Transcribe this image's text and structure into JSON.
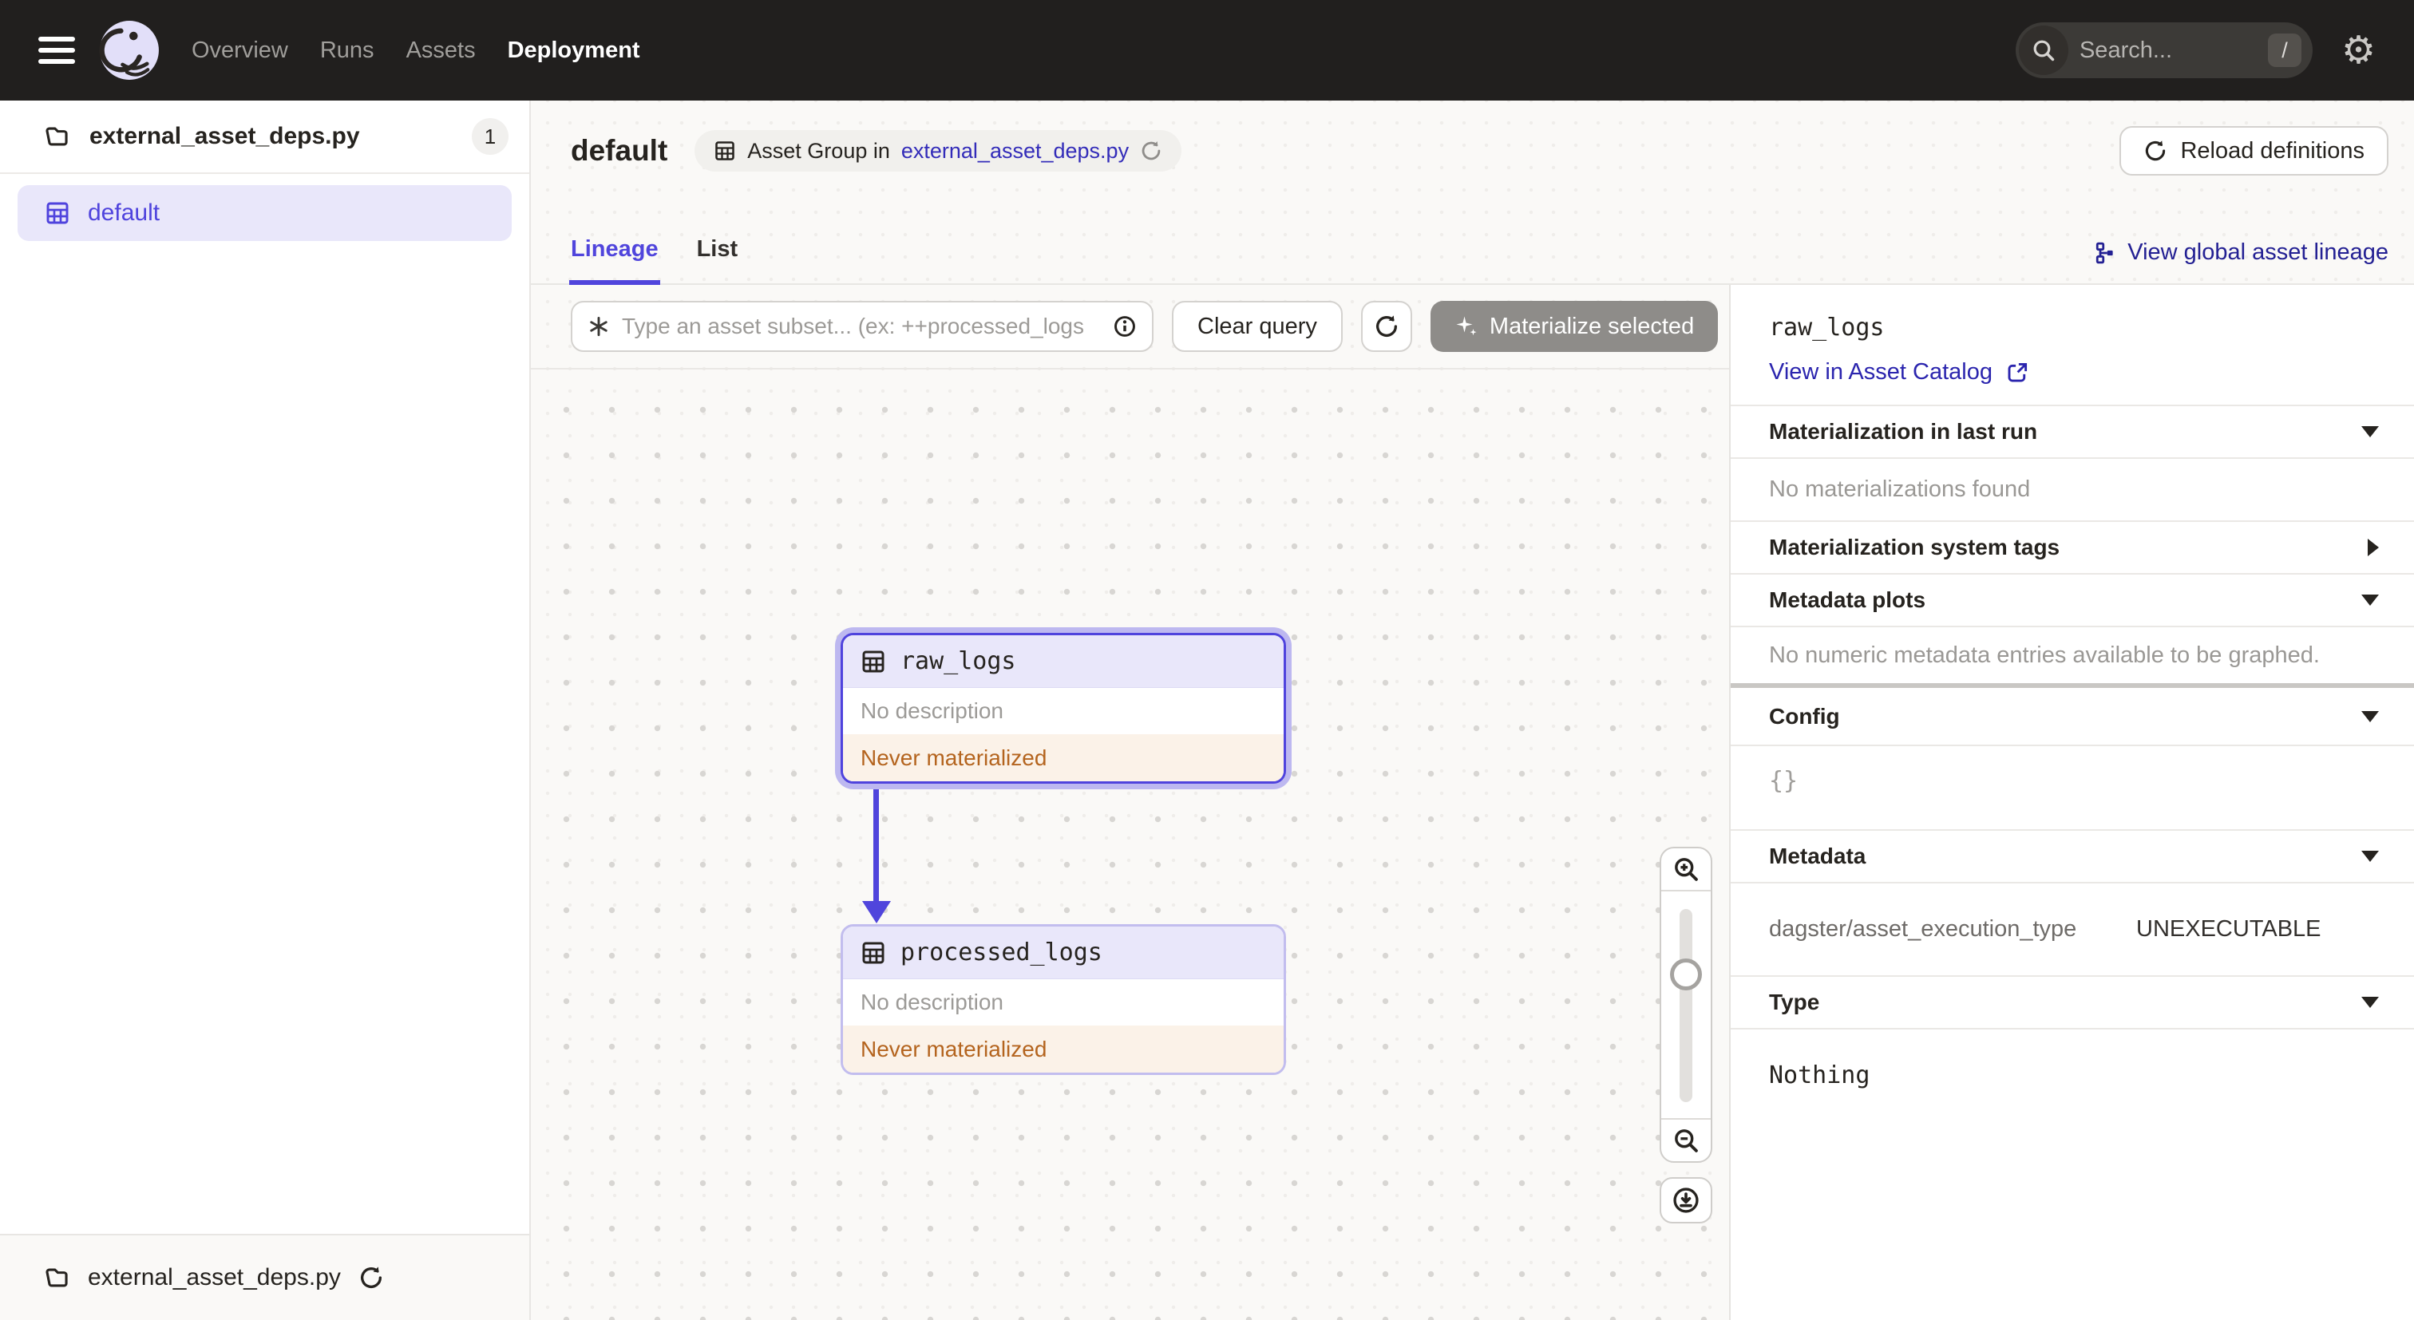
{
  "colors": {
    "accent": "#4F43DD",
    "link": "#2B25AE",
    "nav_bg": "#211F1E",
    "warning_text": "#B4641E",
    "warning_bg": "#FBF2E8",
    "selected_bg": "#E9E7FA"
  },
  "nav": {
    "items": [
      {
        "label": "Overview"
      },
      {
        "label": "Runs"
      },
      {
        "label": "Assets"
      },
      {
        "label": "Deployment"
      }
    ]
  },
  "search": {
    "placeholder": "Search...",
    "shortcut": "/"
  },
  "sidebar": {
    "file": {
      "label": "external_asset_deps.py",
      "count": "1"
    },
    "selected_group": {
      "label": "default"
    },
    "footer": {
      "label": "external_asset_deps.py"
    }
  },
  "header": {
    "title": "default",
    "breadcrumb_prefix": "Asset Group in",
    "breadcrumb_link": "external_asset_deps.py",
    "reload_button": "Reload definitions"
  },
  "tabs": {
    "lineage": "Lineage",
    "list": "List",
    "global_link": "View global asset lineage"
  },
  "toolbar": {
    "query_placeholder": "Type an asset subset... (ex: ++processed_logs",
    "clear_button": "Clear query",
    "materialize_button": "Materialize selected"
  },
  "graph": {
    "nodes": [
      {
        "name": "raw_logs",
        "description": "No description",
        "status": "Never materialized"
      },
      {
        "name": "processed_logs",
        "description": "No description",
        "status": "Never materialized"
      }
    ]
  },
  "panel": {
    "title": "raw_logs",
    "catalog_link": "View in Asset Catalog",
    "sections": {
      "last_run": {
        "label": "Materialization in last run",
        "empty": "No materializations found"
      },
      "system_tags": {
        "label": "Materialization system tags"
      },
      "metadata_plots": {
        "label": "Metadata plots",
        "empty": "No numeric metadata entries available to be graphed."
      },
      "config": {
        "label": "Config",
        "value": "{}"
      },
      "metadata": {
        "label": "Metadata",
        "key": "dagster/asset_execution_type",
        "value": "UNEXECUTABLE"
      },
      "type": {
        "label": "Type",
        "value": "Nothing"
      }
    }
  }
}
